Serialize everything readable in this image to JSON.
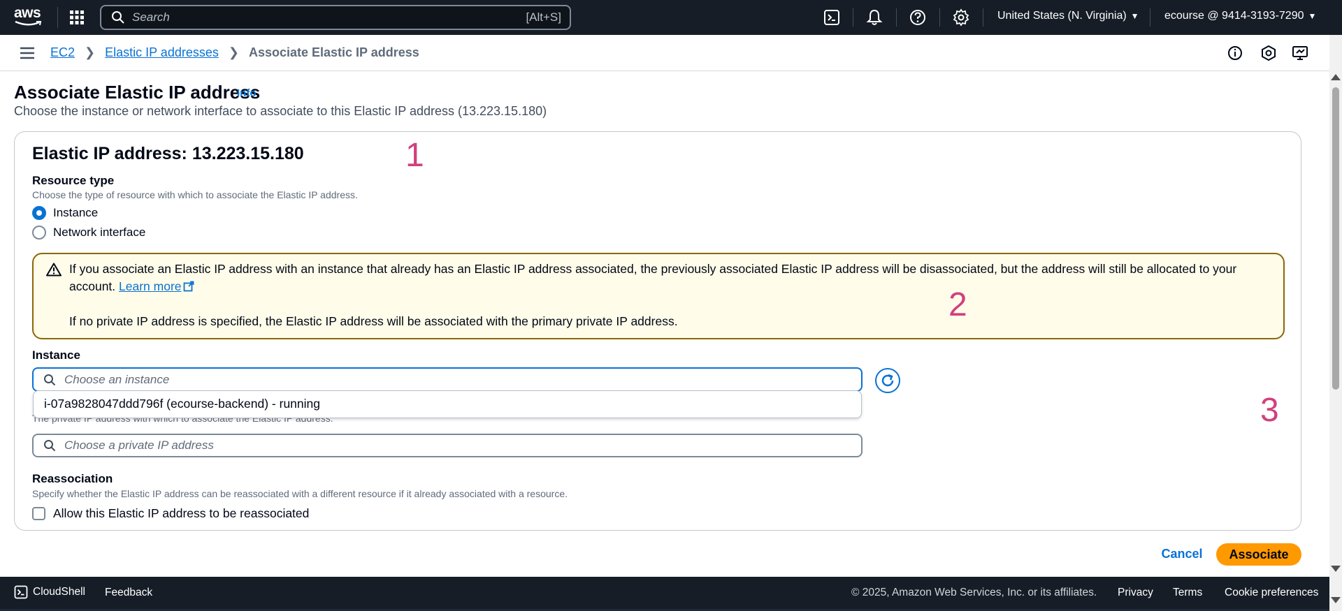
{
  "topnav": {
    "logo_text": "aws",
    "search_placeholder": "Search",
    "search_shortcut": "[Alt+S]",
    "region": "United States (N. Virginia)",
    "account": "ecourse @ 9414-3193-7290",
    "icons": [
      "cloudshell-icon",
      "bell-icon",
      "help-icon",
      "gear-icon"
    ]
  },
  "breadcrumb": {
    "items": [
      "EC2",
      "Elastic IP addresses"
    ],
    "current": "Associate Elastic IP address"
  },
  "page": {
    "title": "Associate Elastic IP address",
    "info": "Info",
    "description": "Choose the instance or network interface to associate to this Elastic IP address (13.223.15.180)"
  },
  "card": {
    "title": "Elastic IP address: 13.223.15.180",
    "resource_type": {
      "label": "Resource type",
      "description": "Choose the type of resource with which to associate the Elastic IP address.",
      "options": [
        {
          "label": "Instance",
          "selected": true
        },
        {
          "label": "Network interface",
          "selected": false
        }
      ]
    },
    "alert": {
      "line1": "If you associate an Elastic IP address with an instance that already has an Elastic IP address associated, the previously associated Elastic IP address will be disassociated, but the address will still be allocated to your",
      "line2_prefix": "account.",
      "learn_more": "Learn more",
      "line3": "If no private IP address is specified, the Elastic IP address will be associated with the primary private IP address."
    },
    "instance": {
      "label": "Instance",
      "placeholder": "Choose an instance",
      "dropdown_option": "i-07a9828047ddd796f (ecourse-backend) - running"
    },
    "private_ip": {
      "description": "The private IP address with which to associate the Elastic IP address.",
      "placeholder": "Choose a private IP address"
    },
    "reassociation": {
      "label": "Reassociation",
      "description": "Specify whether the Elastic IP address can be reassociated with a different resource if it already associated with a resource.",
      "checkbox_label": "Allow this Elastic IP address to be reassociated",
      "checked": false
    }
  },
  "annotations": [
    "1",
    "2",
    "3"
  ],
  "actions": {
    "cancel": "Cancel",
    "associate": "Associate"
  },
  "footer": {
    "cloudshell": "CloudShell",
    "feedback": "Feedback",
    "copyright": "© 2025, Amazon Web Services, Inc. or its affiliates.",
    "privacy": "Privacy",
    "terms": "Terms",
    "cookies": "Cookie preferences"
  },
  "colors": {
    "nav_bg": "#161d26",
    "link": "#0972d3",
    "primary_button": "#ff9900",
    "alert_bg": "#fffce9",
    "alert_border": "#8d6605",
    "annotation": "#d1407e"
  }
}
